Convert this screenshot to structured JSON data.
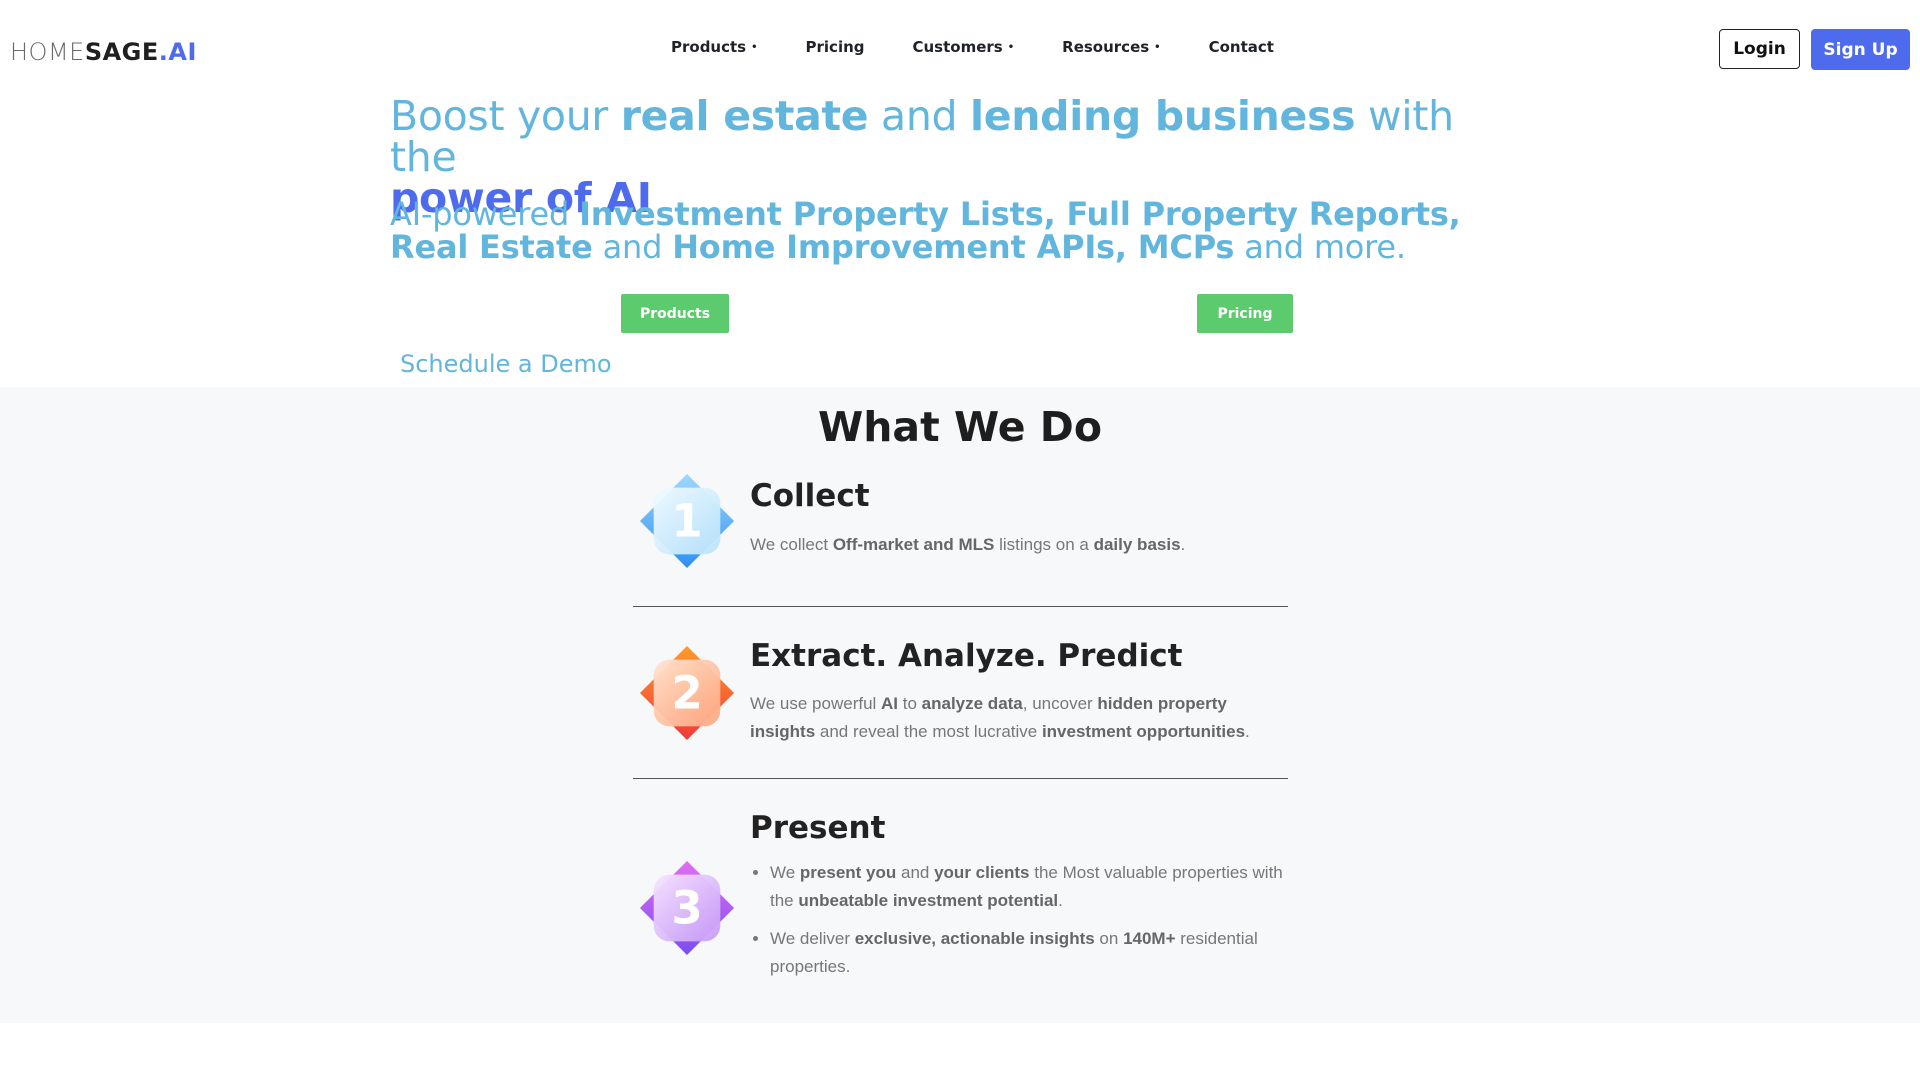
{
  "nav": {
    "logo": {
      "part1": "HOME",
      "part2": "SAGE",
      "part3": ".AI"
    },
    "items": [
      {
        "label": "Products",
        "dropdown": true
      },
      {
        "label": "Pricing",
        "dropdown": false
      },
      {
        "label": "Customers",
        "dropdown": true
      },
      {
        "label": "Resources",
        "dropdown": true
      },
      {
        "label": "Contact",
        "dropdown": false
      }
    ],
    "dropdown_marker": "•",
    "login": "Login",
    "signup": "Sign Up"
  },
  "hero": {
    "title": {
      "t1": "Boost your ",
      "t2": "real estate",
      "t3": " and ",
      "t4": "lending business",
      "t5": " with the ",
      "t6": "power of AI"
    },
    "subtitle": {
      "s1": "AI-powered ",
      "s2": "Investment Property Lists, Full Property Reports, Real Estate",
      "s3": " and ",
      "s4": "Home Improvement APIs, MCPs",
      "s5": " and more."
    },
    "buttons": {
      "products": "Products",
      "pricing": "Pricing"
    },
    "demo": "Schedule a Demo"
  },
  "what_we_do": {
    "title": "What We Do",
    "steps": [
      {
        "number": "1",
        "title": "Collect",
        "text": {
          "a": "We collect ",
          "b": "Off-market and MLS",
          "c": " listings on a ",
          "d": "daily basis",
          "e": "."
        }
      },
      {
        "number": "2",
        "title": "Extract. Analyze. Predict",
        "text": {
          "a": "We use powerful ",
          "b": "AI",
          "c": " to ",
          "d": "analyze data",
          "e": ", uncover ",
          "f": "hidden property insights",
          "g": " and reveal the most lucrative ",
          "h": "investment opportunities",
          "i": "."
        }
      },
      {
        "number": "3",
        "title": "Present",
        "bullets": [
          {
            "a": "We ",
            "b": "present you",
            "c": " and ",
            "d": "your clients",
            "e": " the Most valuable properties with the ",
            "f": "unbeatable investment potential",
            "g": "."
          },
          {
            "a": "We deliver ",
            "b": "exclusive, actionable insights",
            "c": " on ",
            "d": "140M+",
            "e": " residential properties."
          }
        ]
      }
    ]
  },
  "colors": {
    "accent": "#4f6bed",
    "hero_text": "#62b6dd",
    "green_button": "#5bcb6e",
    "section_bg": "#f7f8fa",
    "step1": "#4aa8ee",
    "step2": "#f36f2a",
    "step3": "#b05af0"
  }
}
